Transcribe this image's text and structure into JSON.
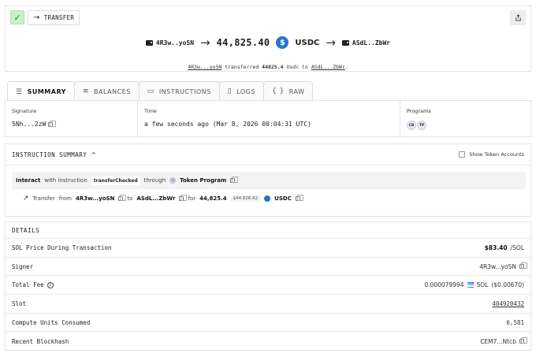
{
  "header": {
    "type_label": "TRANSFER",
    "from_short": "4R3w..yoSN",
    "amount": "44,825.40",
    "token": "USDC",
    "to_short": "ASdL..ZbWr",
    "summary": {
      "from": "4R3w...yoSN",
      "verb": "transferred",
      "amount": "44825.4",
      "unit": "Usdc to",
      "to": "ASdL...ZbWr",
      "end": "."
    }
  },
  "tabs": [
    {
      "label": "SUMMARY",
      "icon": "summary-icon"
    },
    {
      "label": "BALANCES",
      "icon": "balances-icon"
    },
    {
      "label": "INSTRUCTIONS",
      "icon": "instructions-icon"
    },
    {
      "label": "LOGS",
      "icon": "logs-icon"
    },
    {
      "label": "RAW",
      "icon": "raw-icon"
    }
  ],
  "info": {
    "signature_label": "Signature",
    "signature": "5Nh...2zW",
    "time_label": "Time",
    "time": "a few seconds ago (Mar 8, 2026 00:04:31 UTC)",
    "programs_label": "Programs",
    "programs": [
      "CB",
      "TP"
    ]
  },
  "instruction_summary": {
    "title": "INSTRUCTION SUMMARY",
    "show_token_accounts": "Show Token Accounts",
    "interact": "Interact",
    "with_instruction": "with instruction",
    "instruction_name": "transferChecked",
    "through": "through",
    "program": "Token Program",
    "program_icon_text": "TP",
    "transfer": {
      "label": "Transfer",
      "from_word": "from",
      "from": "4R3w...yoSN",
      "to_word": "to",
      "to": "ASdL...ZbWr",
      "for_word": "for",
      "amount": "44,825.4",
      "usd": "$44,826.62",
      "token": "USDC"
    }
  },
  "details": {
    "title": "DETAILS",
    "rows": [
      {
        "label": "SOL Price During Transaction",
        "value": "$83.40",
        "suffix": "/SOL"
      },
      {
        "label": "Signer",
        "value": "4R3w...yoSN"
      },
      {
        "label": "Total Fee",
        "value": "0.000079994",
        "token": "SOL",
        "usd": "($0.00670)"
      },
      {
        "label": "Slot",
        "value": "404920432"
      },
      {
        "label": "Compute Units Consumed",
        "value": "6,581"
      },
      {
        "label": "Recent Blockhash",
        "value": "CEM7...Ntcb"
      }
    ]
  },
  "colors": {
    "success_bg": "#c9f0c9",
    "success_fg": "#1f8f1f",
    "usdc": "#2775ca",
    "border": "#e4e4e4"
  }
}
